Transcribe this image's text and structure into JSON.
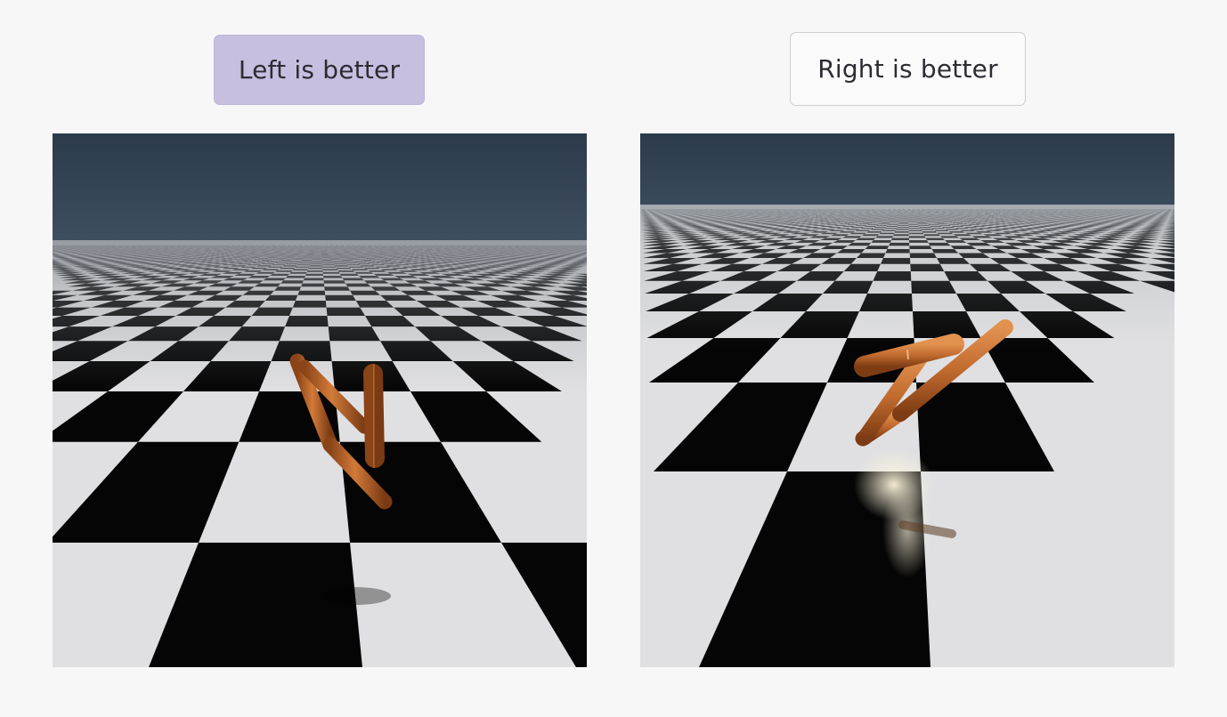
{
  "buttons": {
    "left_label": "Left is better",
    "right_label": "Right is better",
    "left_selected": true
  },
  "scene": {
    "sky_top_color": "#2c3a4a",
    "sky_bottom_color": "#3c4d5e",
    "floor_light_color": "#e0e0e2",
    "floor_dark_color": "#050505",
    "robot_color": "#c06a2e",
    "robot_highlight_color": "#e59a5a"
  }
}
